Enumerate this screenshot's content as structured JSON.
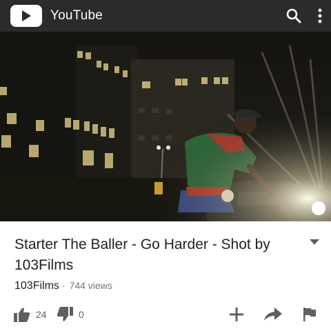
{
  "appbar": {
    "logo_text": "YouTube",
    "colors": {
      "bar": "#2b2b2b",
      "icon": "#ffffff"
    }
  },
  "video": {
    "title": "Starter The Baller - Go Harder - Shot by 103Films",
    "channel": "103Films",
    "separator": "·",
    "views": "744 views"
  },
  "actions": {
    "likes": "24",
    "dislikes": "0"
  },
  "icons": [
    "youtube-play-icon",
    "search-icon",
    "more-vert-icon",
    "chevron-down-icon",
    "thumb-up-icon",
    "thumb-down-icon",
    "add-icon",
    "share-icon",
    "flag-icon"
  ],
  "colors": {
    "text_primary": "#212121",
    "text_secondary": "#757575",
    "icon_gray": "#5f5f5f"
  }
}
